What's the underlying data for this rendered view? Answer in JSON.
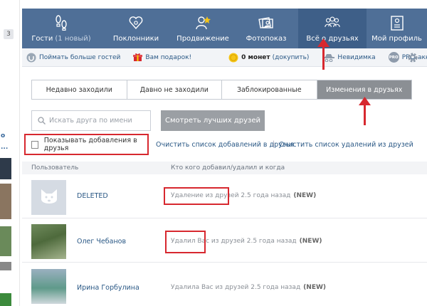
{
  "left_strip": {
    "badge": "3",
    "letter": "о",
    "dots": "..."
  },
  "nav": {
    "items": [
      {
        "label": "Гости",
        "extra": "(1 новый)",
        "icon": "footprints-icon"
      },
      {
        "label": "Поклонники",
        "icon": "heart-person-icon"
      },
      {
        "label": "Продвижение",
        "icon": "star-person-icon"
      },
      {
        "label": "Фотопоказ",
        "icon": "photos-icon"
      },
      {
        "label": "Всё о друзьях",
        "icon": "group-icon"
      },
      {
        "label": "Мой профиль",
        "icon": "profile-icon"
      }
    ],
    "active_index": 4,
    "bg": "#4f6f97"
  },
  "subrow": {
    "more_guests": "Поймать больше гостей",
    "gift": "Вам подарок!",
    "coins_count": "0 монет",
    "coins_buy": "(докупить)",
    "invisible": "Невидимка",
    "pro": "PRO-аккаунт",
    "pro_badge": "PRO"
  },
  "tabs": [
    "Недавно заходили",
    "Давно не заходили",
    "Заблокированные",
    "Изменения в друзьях"
  ],
  "search": {
    "placeholder": "Искать друга по имени"
  },
  "best_button": "Смотреть лучших друзей",
  "checkbox_label": "Показывать добавления в друзья",
  "links": {
    "clear_adds": "Очистить список добавлений в друзья",
    "separator": "|",
    "clear_removes": "Очистить список удалений из друзей"
  },
  "table": {
    "col_user": "Пользователь",
    "col_change": "Кто кого добавил/удалил и когда",
    "rows": [
      {
        "name": "DELETED",
        "change": "Удаление из друзей 2.5 года назад",
        "badge": "(NEW)"
      },
      {
        "name": "Олег Чебанов",
        "change": "Удалил Вас из друзей 2.5 года назад",
        "badge": "(NEW)"
      },
      {
        "name": "Ирина Горбулина",
        "change": "Удалила Вас из друзей 2.5 года назад",
        "badge": "(NEW)"
      }
    ]
  },
  "colors": {
    "accent_red": "#d7282f",
    "link_blue": "#2a5885",
    "tab_active": "#8b8f94"
  }
}
